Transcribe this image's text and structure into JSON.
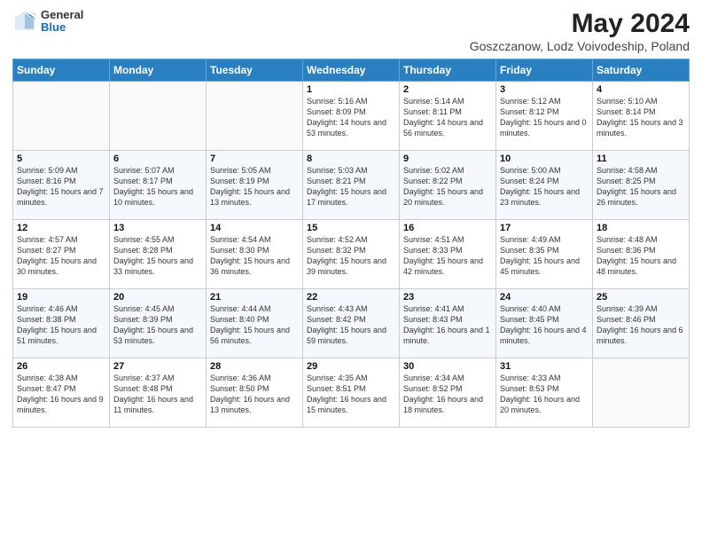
{
  "header": {
    "logo": {
      "general": "General",
      "blue": "Blue"
    },
    "title": "May 2024",
    "subtitle": "Goszczanow, Lodz Voivodeship, Poland"
  },
  "calendar": {
    "weekdays": [
      "Sunday",
      "Monday",
      "Tuesday",
      "Wednesday",
      "Thursday",
      "Friday",
      "Saturday"
    ],
    "rows": [
      [
        {
          "day": "",
          "info": ""
        },
        {
          "day": "",
          "info": ""
        },
        {
          "day": "",
          "info": ""
        },
        {
          "day": "1",
          "info": "Sunrise: 5:16 AM\nSunset: 8:09 PM\nDaylight: 14 hours and 53 minutes."
        },
        {
          "day": "2",
          "info": "Sunrise: 5:14 AM\nSunset: 8:11 PM\nDaylight: 14 hours and 56 minutes."
        },
        {
          "day": "3",
          "info": "Sunrise: 5:12 AM\nSunset: 8:12 PM\nDaylight: 15 hours and 0 minutes."
        },
        {
          "day": "4",
          "info": "Sunrise: 5:10 AM\nSunset: 8:14 PM\nDaylight: 15 hours and 3 minutes."
        }
      ],
      [
        {
          "day": "5",
          "info": "Sunrise: 5:09 AM\nSunset: 8:16 PM\nDaylight: 15 hours and 7 minutes."
        },
        {
          "day": "6",
          "info": "Sunrise: 5:07 AM\nSunset: 8:17 PM\nDaylight: 15 hours and 10 minutes."
        },
        {
          "day": "7",
          "info": "Sunrise: 5:05 AM\nSunset: 8:19 PM\nDaylight: 15 hours and 13 minutes."
        },
        {
          "day": "8",
          "info": "Sunrise: 5:03 AM\nSunset: 8:21 PM\nDaylight: 15 hours and 17 minutes."
        },
        {
          "day": "9",
          "info": "Sunrise: 5:02 AM\nSunset: 8:22 PM\nDaylight: 15 hours and 20 minutes."
        },
        {
          "day": "10",
          "info": "Sunrise: 5:00 AM\nSunset: 8:24 PM\nDaylight: 15 hours and 23 minutes."
        },
        {
          "day": "11",
          "info": "Sunrise: 4:58 AM\nSunset: 8:25 PM\nDaylight: 15 hours and 26 minutes."
        }
      ],
      [
        {
          "day": "12",
          "info": "Sunrise: 4:57 AM\nSunset: 8:27 PM\nDaylight: 15 hours and 30 minutes."
        },
        {
          "day": "13",
          "info": "Sunrise: 4:55 AM\nSunset: 8:28 PM\nDaylight: 15 hours and 33 minutes."
        },
        {
          "day": "14",
          "info": "Sunrise: 4:54 AM\nSunset: 8:30 PM\nDaylight: 15 hours and 36 minutes."
        },
        {
          "day": "15",
          "info": "Sunrise: 4:52 AM\nSunset: 8:32 PM\nDaylight: 15 hours and 39 minutes."
        },
        {
          "day": "16",
          "info": "Sunrise: 4:51 AM\nSunset: 8:33 PM\nDaylight: 15 hours and 42 minutes."
        },
        {
          "day": "17",
          "info": "Sunrise: 4:49 AM\nSunset: 8:35 PM\nDaylight: 15 hours and 45 minutes."
        },
        {
          "day": "18",
          "info": "Sunrise: 4:48 AM\nSunset: 8:36 PM\nDaylight: 15 hours and 48 minutes."
        }
      ],
      [
        {
          "day": "19",
          "info": "Sunrise: 4:46 AM\nSunset: 8:38 PM\nDaylight: 15 hours and 51 minutes."
        },
        {
          "day": "20",
          "info": "Sunrise: 4:45 AM\nSunset: 8:39 PM\nDaylight: 15 hours and 53 minutes."
        },
        {
          "day": "21",
          "info": "Sunrise: 4:44 AM\nSunset: 8:40 PM\nDaylight: 15 hours and 56 minutes."
        },
        {
          "day": "22",
          "info": "Sunrise: 4:43 AM\nSunset: 8:42 PM\nDaylight: 15 hours and 59 minutes."
        },
        {
          "day": "23",
          "info": "Sunrise: 4:41 AM\nSunset: 8:43 PM\nDaylight: 16 hours and 1 minute."
        },
        {
          "day": "24",
          "info": "Sunrise: 4:40 AM\nSunset: 8:45 PM\nDaylight: 16 hours and 4 minutes."
        },
        {
          "day": "25",
          "info": "Sunrise: 4:39 AM\nSunset: 8:46 PM\nDaylight: 16 hours and 6 minutes."
        }
      ],
      [
        {
          "day": "26",
          "info": "Sunrise: 4:38 AM\nSunset: 8:47 PM\nDaylight: 16 hours and 9 minutes."
        },
        {
          "day": "27",
          "info": "Sunrise: 4:37 AM\nSunset: 8:48 PM\nDaylight: 16 hours and 11 minutes."
        },
        {
          "day": "28",
          "info": "Sunrise: 4:36 AM\nSunset: 8:50 PM\nDaylight: 16 hours and 13 minutes."
        },
        {
          "day": "29",
          "info": "Sunrise: 4:35 AM\nSunset: 8:51 PM\nDaylight: 16 hours and 15 minutes."
        },
        {
          "day": "30",
          "info": "Sunrise: 4:34 AM\nSunset: 8:52 PM\nDaylight: 16 hours and 18 minutes."
        },
        {
          "day": "31",
          "info": "Sunrise: 4:33 AM\nSunset: 8:53 PM\nDaylight: 16 hours and 20 minutes."
        },
        {
          "day": "",
          "info": ""
        }
      ]
    ]
  }
}
